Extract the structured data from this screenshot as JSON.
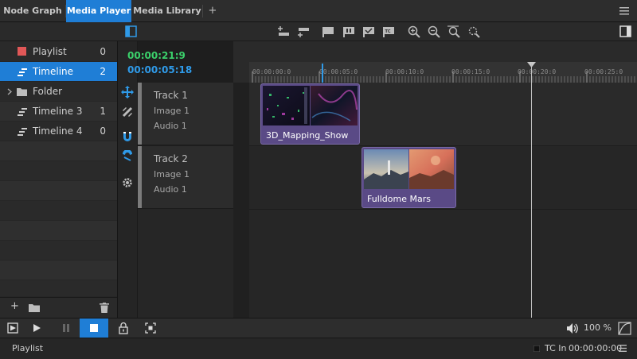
{
  "tabs": [
    {
      "label": "Node Graph",
      "active": false
    },
    {
      "label": "Media Player",
      "active": true
    },
    {
      "label": "Media Library",
      "active": false
    }
  ],
  "add_tab_label": "+",
  "sidebar": {
    "items": [
      {
        "label": "Playlist",
        "count": "0",
        "icon": "playlist-icon"
      },
      {
        "label": "Timeline",
        "count": "2",
        "icon": "timeline-icon",
        "selected": true
      },
      {
        "label": "Folder",
        "count": "",
        "icon": "folder-icon"
      },
      {
        "label": "Timeline 3",
        "count": "1",
        "icon": "timeline-icon"
      },
      {
        "label": "Timeline 4",
        "count": "0",
        "icon": "timeline-icon"
      }
    ],
    "bottom_add": "+"
  },
  "timecode": {
    "current": "00:00:21:9",
    "duration": "00:00:05:18"
  },
  "tracks": [
    {
      "name": "Track 1",
      "image": "Image 1",
      "audio": "Audio 1"
    },
    {
      "name": "Track 2",
      "image": "Image 1",
      "audio": "Audio 1"
    }
  ],
  "ruler": {
    "labels": [
      "00:00:00:0",
      "00:00:05:0",
      "00:00:10:0",
      "00:00:15:0",
      "00:00:20:0",
      "00:00:25:0"
    ]
  },
  "clips": [
    {
      "label": "3D_Mapping_Show"
    },
    {
      "label": "Fulldome Mars"
    }
  ],
  "transport": {
    "volume": "100 %"
  },
  "status": {
    "left": "Playlist",
    "tc_in_label": "TC In",
    "tc_in_value": "00:00:00:00"
  },
  "colors": {
    "accent": "#1f7ed6",
    "timecode_green": "#3bd16b",
    "timecode_blue": "#2f9ae8",
    "clip": "#5a4a86",
    "playlist_marker": "#e05757"
  }
}
